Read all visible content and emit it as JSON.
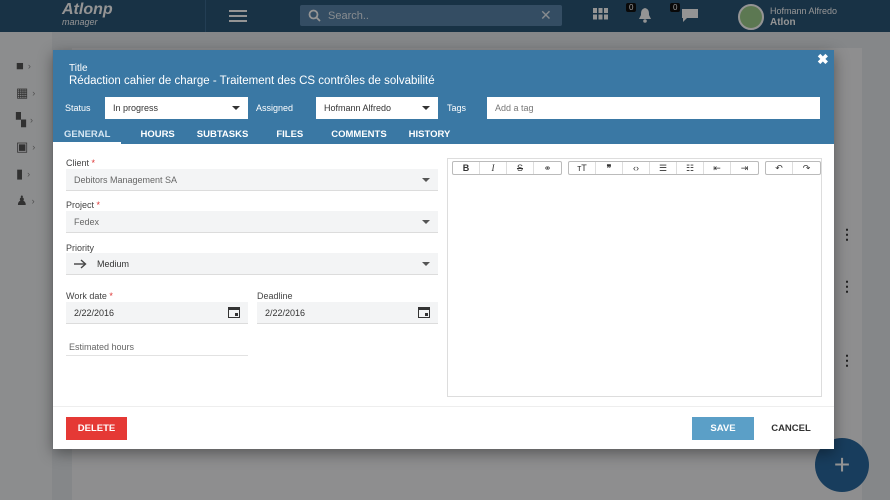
{
  "topbar": {
    "brand": "Atlonp",
    "brand_sub": "manager",
    "search_placeholder": "Search..",
    "search_clear": "✕",
    "notif_count": "0",
    "msg_count": "0",
    "user_name": "Hofmann Alfredo",
    "user_org": "Atlon"
  },
  "modal": {
    "title_label": "Title",
    "title": "Rédaction cahier de charge - Traitement des CS contrôles de solvabilité",
    "close": "✖",
    "status_label": "Status",
    "status_value": "In progress",
    "assigned_label": "Assigned",
    "assigned_value": "Hofmann Alfredo",
    "tags_label": "Tags",
    "tags_placeholder": "Add a tag",
    "tabs": [
      "GENERAL",
      "HOURS",
      "SUBTASKS",
      "FILES",
      "COMMENTS",
      "HISTORY"
    ],
    "client_label": "Client",
    "client_value": "Debitors Management SA",
    "project_label": "Project",
    "project_value": "Fedex",
    "priority_label": "Priority",
    "priority_value": "Medium",
    "workdate_label": "Work date",
    "workdate_value": "2/22/2016",
    "deadline_label": "Deadline",
    "deadline_value": "2/22/2016",
    "hours_placeholder": "Estimated hours",
    "required_mark": "*",
    "delete_label": "DELETE",
    "save_label": "SAVE",
    "cancel_label": "CANCEL"
  },
  "colors": {
    "topbar": "#2a5678",
    "modal_header": "#3a78a4",
    "delete": "#e53935",
    "save": "#5b9fc7"
  }
}
